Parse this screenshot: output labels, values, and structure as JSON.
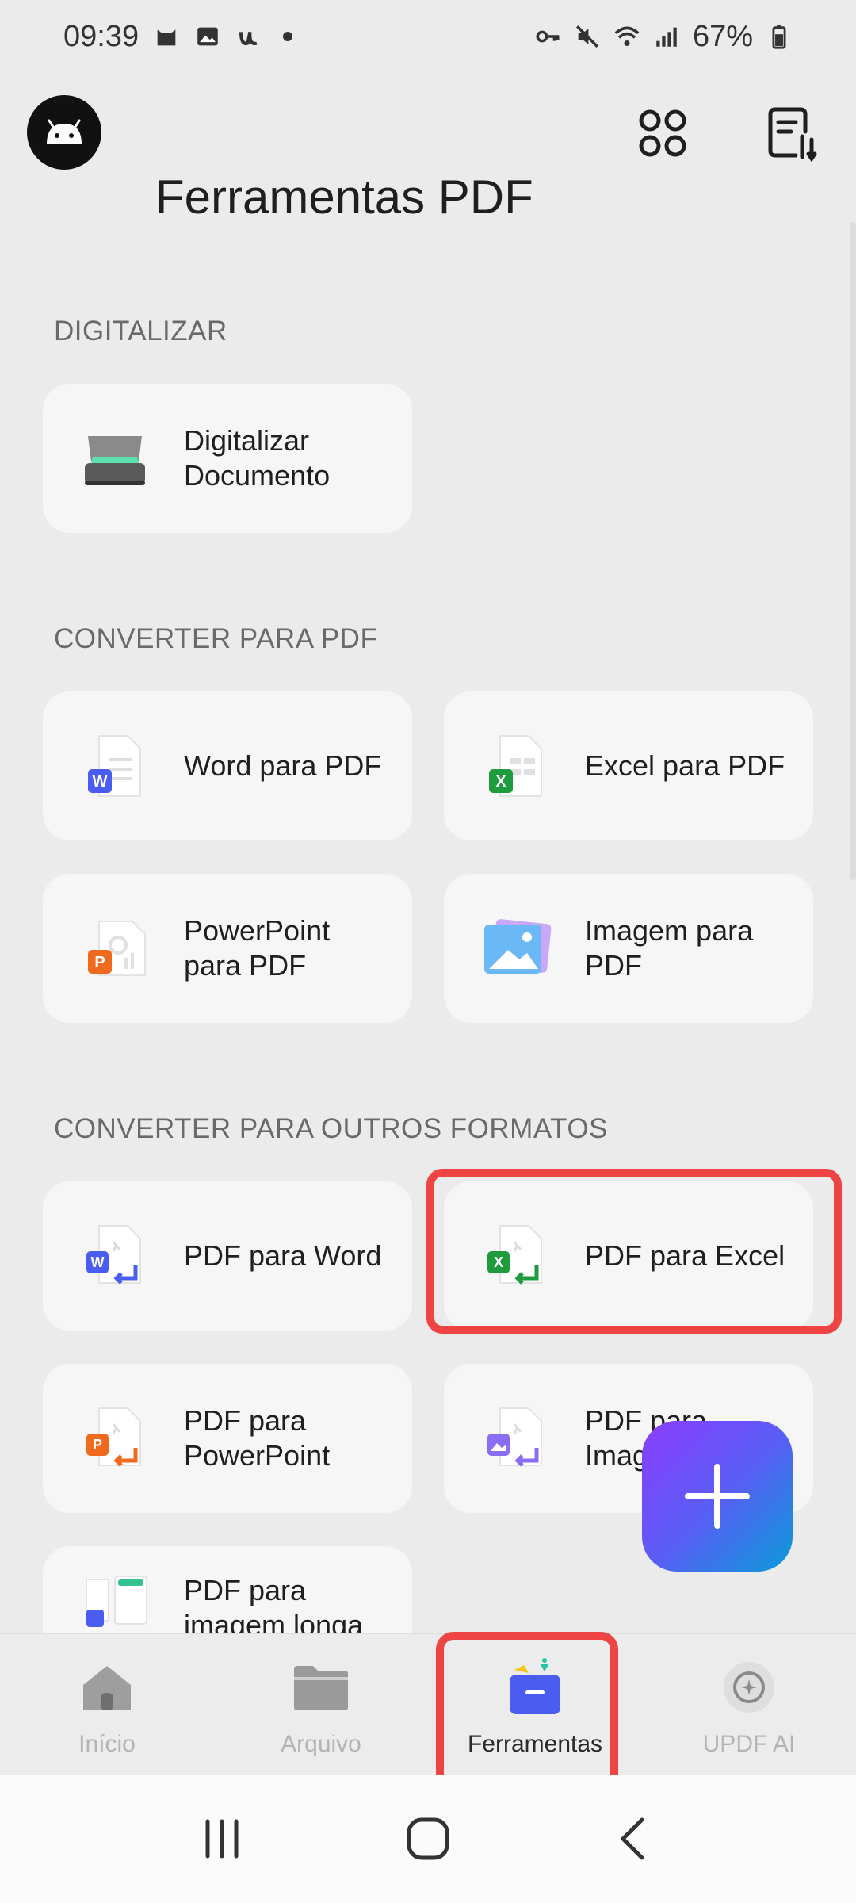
{
  "status_bar": {
    "time": "09:39",
    "battery": "67%"
  },
  "header": {
    "title": "Ferramentas PDF"
  },
  "sections": {
    "scan": {
      "title": "DIGITALIZAR",
      "items": [
        {
          "label": "Digitalizar Documento",
          "icon": "scanner-icon"
        }
      ]
    },
    "to_pdf": {
      "title": "CONVERTER PARA PDF",
      "items": [
        {
          "label": "Word para PDF",
          "icon": "word-doc-icon"
        },
        {
          "label": "Excel para PDF",
          "icon": "excel-doc-icon"
        },
        {
          "label": "PowerPoint para PDF",
          "icon": "powerpoint-doc-icon"
        },
        {
          "label": "Imagem para PDF",
          "icon": "image-stack-icon"
        }
      ]
    },
    "to_other": {
      "title": "CONVERTER PARA OUTROS FORMATOS",
      "items": [
        {
          "label": "PDF para Word",
          "icon": "pdf-to-word-icon"
        },
        {
          "label": "PDF para Excel",
          "icon": "pdf-to-excel-icon"
        },
        {
          "label": "PDF para PowerPoint",
          "icon": "pdf-to-powerpoint-icon"
        },
        {
          "label": "PDF para Imagem",
          "icon": "pdf-to-image-icon"
        },
        {
          "label": "PDF para imagem longa",
          "icon": "pdf-to-long-image-icon"
        }
      ]
    }
  },
  "bottom_nav": {
    "items": [
      {
        "label": "Início",
        "icon": "home-icon"
      },
      {
        "label": "Arquivo",
        "icon": "folder-icon"
      },
      {
        "label": "Ferramentas",
        "icon": "toolbox-icon",
        "active": true
      },
      {
        "label": "UPDF AI",
        "icon": "ai-icon"
      }
    ]
  },
  "colors": {
    "highlight": "#ef4444",
    "fab_gradient": [
      "#8b3dfc",
      "#0a9bd8"
    ],
    "word": "#4b5cf0",
    "excel": "#1e9b3d",
    "powerpoint": "#f06a1e"
  }
}
